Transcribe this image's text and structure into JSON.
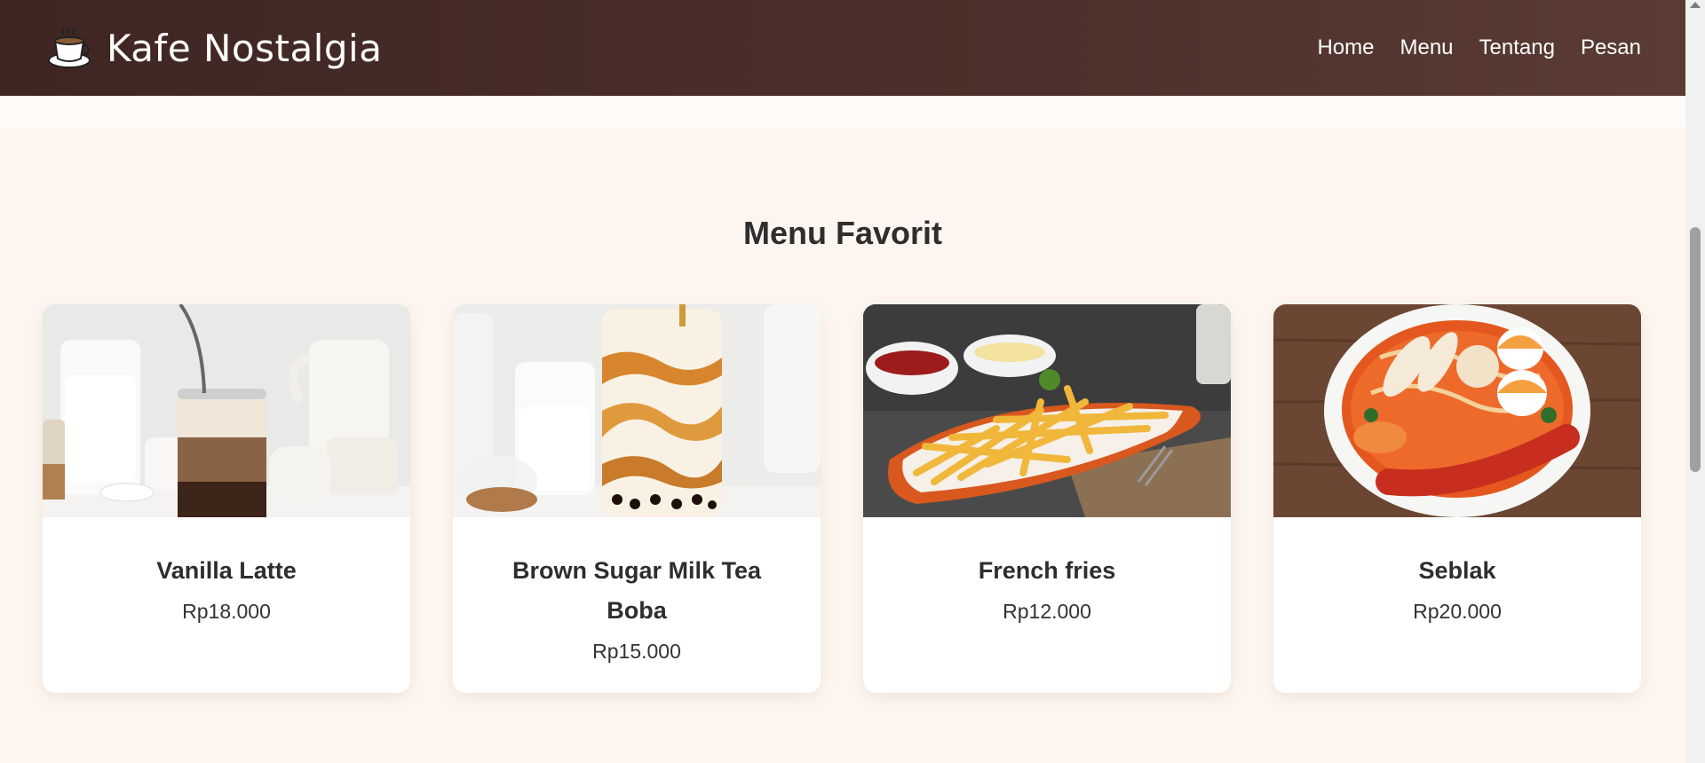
{
  "header": {
    "brand_icon": "coffee-cup-icon",
    "brand_name": "Kafe Nostalgia",
    "nav": [
      "Home",
      "Menu",
      "Tentang",
      "Pesan"
    ]
  },
  "section": {
    "title": "Menu Favorit"
  },
  "menu_items": [
    {
      "name": "Vanilla Latte",
      "price": "Rp18.000",
      "image": "vanilla-latte-photo"
    },
    {
      "name": "Brown Sugar Milk Tea Boba",
      "price": "Rp15.000",
      "image": "brown-sugar-boba-photo"
    },
    {
      "name": "French fries",
      "price": "Rp12.000",
      "image": "french-fries-photo"
    },
    {
      "name": "Seblak",
      "price": "Rp20.000",
      "image": "seblak-photo"
    }
  ],
  "colors": {
    "header": "#4c302b",
    "background": "#fdf6f0",
    "card": "#ffffff",
    "text": "#2e2e2e"
  }
}
